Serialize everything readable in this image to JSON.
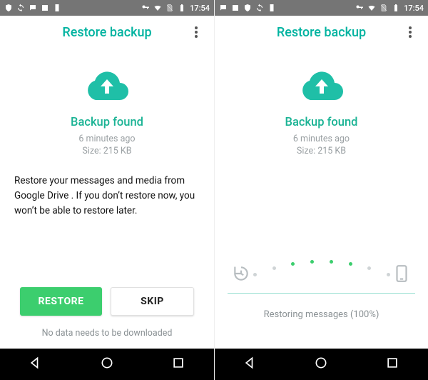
{
  "status": {
    "time": "17:54"
  },
  "header": {
    "title": "Restore backup"
  },
  "backup": {
    "found_title": "Backup found",
    "age": "6 minutes ago",
    "size": "Size: 215 KB"
  },
  "left": {
    "description": "Restore your messages and media from Google Drive . If you don’t restore now, you won’t be able to restore later.",
    "restore_label": "RESTORE",
    "skip_label": "SKIP",
    "footnote": "No data needs to be downloaded"
  },
  "right": {
    "progress_text": "Restoring messages (100%)"
  }
}
